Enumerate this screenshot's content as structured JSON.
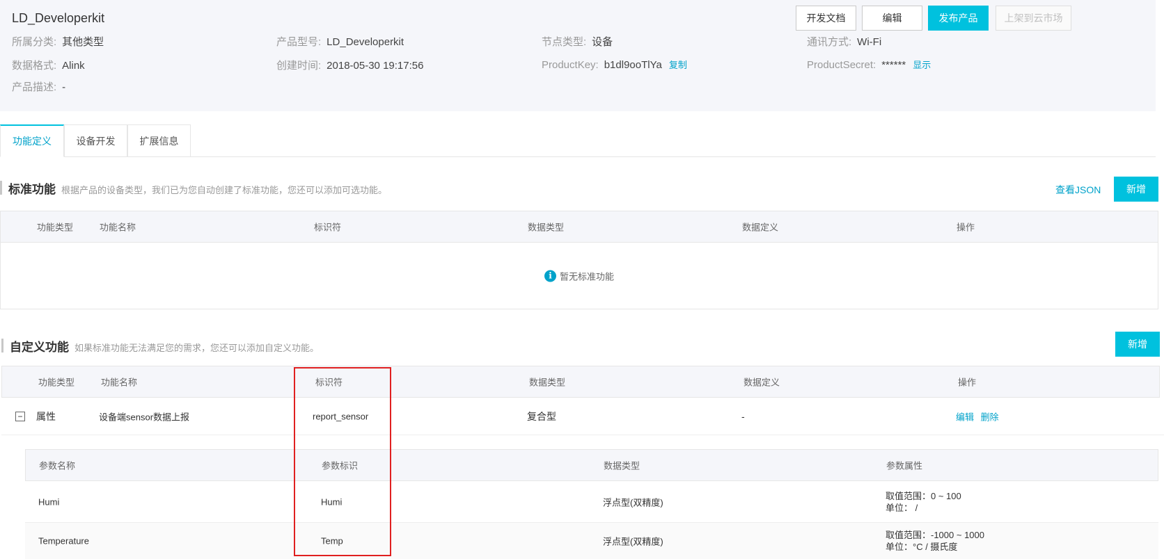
{
  "product": {
    "title": "LD_Developerkit",
    "category_label": "所属分类:",
    "category_value": "其他类型",
    "model_label": "产品型号:",
    "model_value": "LD_Developerkit",
    "node_label": "节点类型:",
    "node_value": "设备",
    "comm_label": "通讯方式:",
    "comm_value": "Wi-Fi",
    "format_label": "数据格式:",
    "format_value": "Alink",
    "created_label": "创建时间:",
    "created_value": "2018-05-30 19:17:56",
    "key_label": "ProductKey:",
    "key_value": "b1dl9ooTlYa",
    "key_copy": "复制",
    "secret_label": "ProductSecret:",
    "secret_value": "******",
    "secret_show": "显示",
    "desc_label": "产品描述:",
    "desc_value": "-"
  },
  "header_buttons": {
    "docs": "开发文档",
    "edit": "编辑",
    "publish": "发布产品",
    "market": "上架到云市场"
  },
  "tabs": [
    "功能定义",
    "设备开发",
    "扩展信息"
  ],
  "standard": {
    "title": "标准功能",
    "desc": "根据产品的设备类型，我们已为您自动创建了标准功能，您还可以添加可选功能。",
    "view_json": "查看JSON",
    "add": "新增",
    "columns": [
      "功能类型",
      "功能名称",
      "标识符",
      "数据类型",
      "数据定义",
      "操作"
    ],
    "empty": "暂无标准功能"
  },
  "custom": {
    "title": "自定义功能",
    "desc": "如果标准功能无法满足您的需求，您还可以添加自定义功能。",
    "add": "新增",
    "columns": [
      "功能类型",
      "功能名称",
      "标识符",
      "数据类型",
      "数据定义",
      "操作"
    ],
    "row": {
      "type": "属性",
      "name": "设备端sensor数据上报",
      "identifier": "report_sensor",
      "data_type": "复合型",
      "definition": "-",
      "edit": "编辑",
      "delete": "删除"
    },
    "sub_columns": [
      "参数名称",
      "参数标识",
      "数据类型",
      "参数属性"
    ],
    "sub_rows": [
      {
        "name": "Humi",
        "id": "Humi",
        "type": "浮点型(双精度)",
        "range": "取值范围：0 ~ 100",
        "unit": "单位： /"
      },
      {
        "name": "Temperature",
        "id": "Temp",
        "type": "浮点型(双精度)",
        "range": "取值范围：-1000 ~ 1000",
        "unit": "单位：°C / 摄氏度"
      }
    ]
  },
  "colors": {
    "accent": "#00c1de",
    "link": "#00a2ca",
    "highlight": "#e02020"
  }
}
